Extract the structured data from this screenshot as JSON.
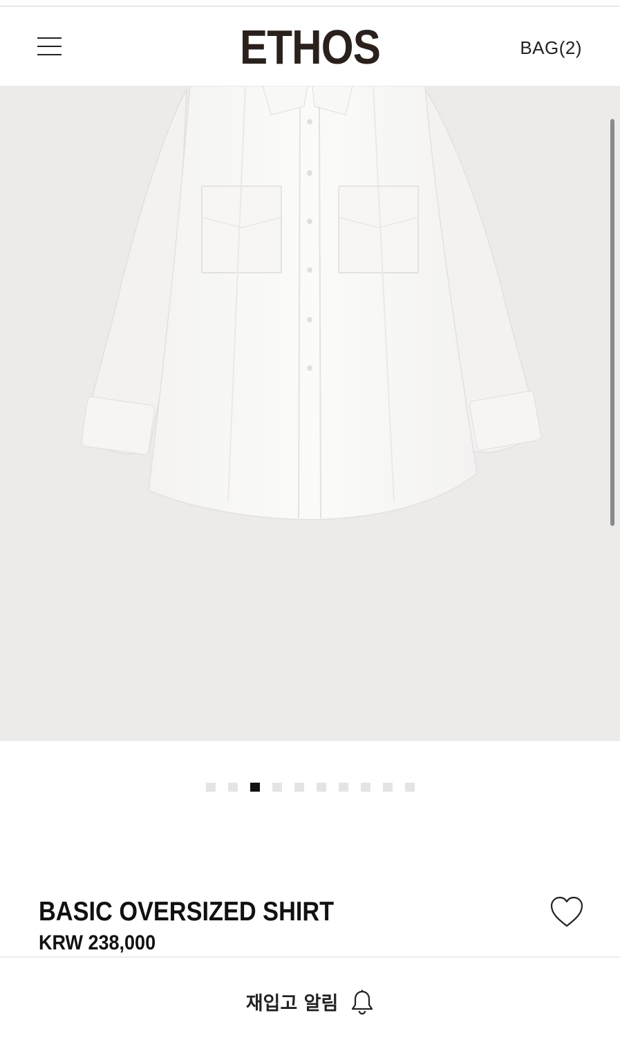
{
  "header": {
    "brand": "ETHOS",
    "bag_label": "BAG(2)",
    "menu_icon": "hamburger-menu-icon"
  },
  "gallery": {
    "image_alt": "white oversized shirt",
    "slide_count": 10,
    "active_index": 2,
    "background_color": "#edebea"
  },
  "product": {
    "name": "BASIC OVERSIZED SHIRT",
    "price": "KRW 238,000",
    "wishlist_icon": "heart-icon"
  },
  "footer_action": {
    "label": "재입고 알림",
    "icon": "bell-icon"
  },
  "colors": {
    "brand_text": "#2a211c",
    "active_dot": "#111111",
    "inactive_dot": "#e4e4e4"
  }
}
